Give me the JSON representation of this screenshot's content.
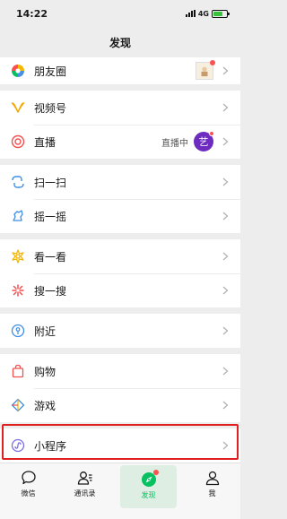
{
  "status_bar": {
    "time": "14:22",
    "network": "4G"
  },
  "header": {
    "title": "发现"
  },
  "groups": [
    {
      "items": [
        {
          "label": "朋友圈",
          "icon": "moments-icon"
        }
      ]
    },
    {
      "items": [
        {
          "label": "视频号",
          "icon": "channels-icon"
        },
        {
          "label": "直播",
          "icon": "live-icon",
          "extra": "直播中",
          "avatar_text": "艺"
        }
      ]
    },
    {
      "items": [
        {
          "label": "扫一扫",
          "icon": "scan-icon"
        },
        {
          "label": "摇一摇",
          "icon": "shake-icon"
        }
      ]
    },
    {
      "items": [
        {
          "label": "看一看",
          "icon": "top-stories-icon"
        },
        {
          "label": "搜一搜",
          "icon": "search-icon"
        }
      ]
    },
    {
      "items": [
        {
          "label": "附近",
          "icon": "nearby-icon"
        }
      ]
    },
    {
      "items": [
        {
          "label": "购物",
          "icon": "shopping-icon"
        },
        {
          "label": "游戏",
          "icon": "games-icon"
        }
      ]
    },
    {
      "items": [
        {
          "label": "小程序",
          "icon": "mini-programs-icon"
        }
      ]
    }
  ],
  "tabs": [
    {
      "label": "微信",
      "icon": "chat-icon"
    },
    {
      "label": "通讯录",
      "icon": "contacts-icon"
    },
    {
      "label": "发现",
      "icon": "discover-icon",
      "active": true
    },
    {
      "label": "我",
      "icon": "me-icon"
    }
  ],
  "colors": {
    "accent": "#07c160",
    "highlight": "#e02020",
    "background": "#ededed"
  }
}
